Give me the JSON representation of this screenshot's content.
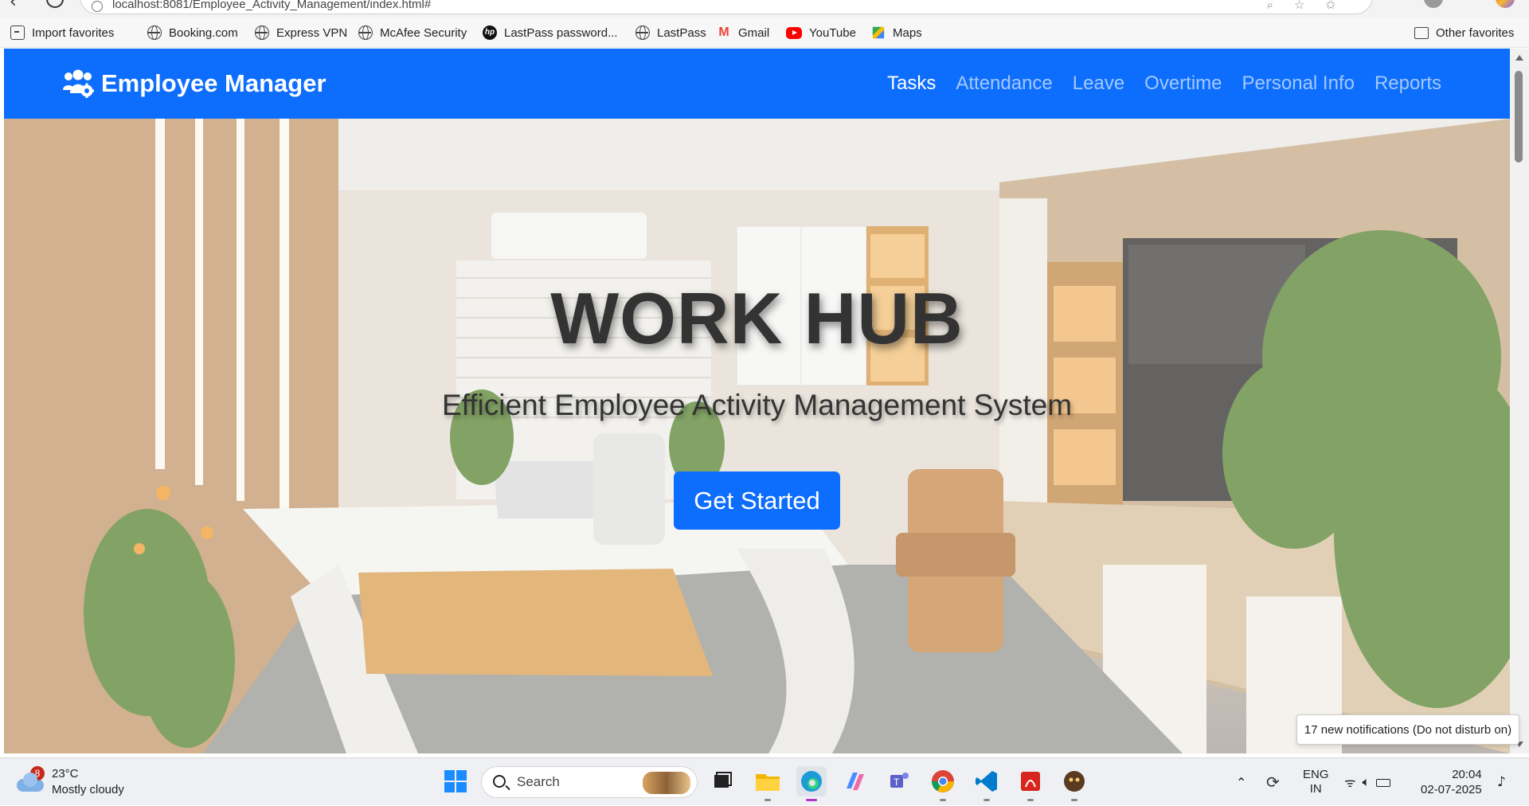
{
  "browser": {
    "url": "localhost:8081/Employee_Activity_Management/index.html#",
    "bookmarks": [
      {
        "label": "Import favorites",
        "icon": "import-icon"
      },
      {
        "label": "Booking.com",
        "icon": "globe-icon"
      },
      {
        "label": "Express VPN",
        "icon": "globe-icon"
      },
      {
        "label": "McAfee Security",
        "icon": "globe-icon"
      },
      {
        "label": "LastPass password...",
        "icon": "hp-icon"
      },
      {
        "label": "LastPass",
        "icon": "globe-icon"
      },
      {
        "label": "Gmail",
        "icon": "gmail-icon"
      },
      {
        "label": "YouTube",
        "icon": "youtube-icon"
      },
      {
        "label": "Maps",
        "icon": "maps-icon"
      }
    ],
    "other_favorites": "Other favorites"
  },
  "navbar": {
    "brand": "Employee Manager",
    "links": [
      {
        "label": "Tasks",
        "active": true
      },
      {
        "label": "Attendance",
        "active": false
      },
      {
        "label": "Leave",
        "active": false
      },
      {
        "label": "Overtime",
        "active": false
      },
      {
        "label": "Personal Info",
        "active": false
      },
      {
        "label": "Reports",
        "active": false
      }
    ]
  },
  "hero": {
    "title": "WORK HUB",
    "subtitle": "Efficient Employee Activity Management System",
    "cta_label": "Get Started"
  },
  "notification_toast": "17 new notifications (Do not disturb on)",
  "taskbar": {
    "weather": {
      "temp": "23°C",
      "condition": "Mostly cloudy",
      "badge": "8"
    },
    "search_placeholder": "Search",
    "language": {
      "line1": "ENG",
      "line2": "IN"
    },
    "clock": {
      "time": "20:04",
      "date": "02-07-2025"
    }
  },
  "colors": {
    "primary": "#0d6efd",
    "title_text": "#333333"
  }
}
